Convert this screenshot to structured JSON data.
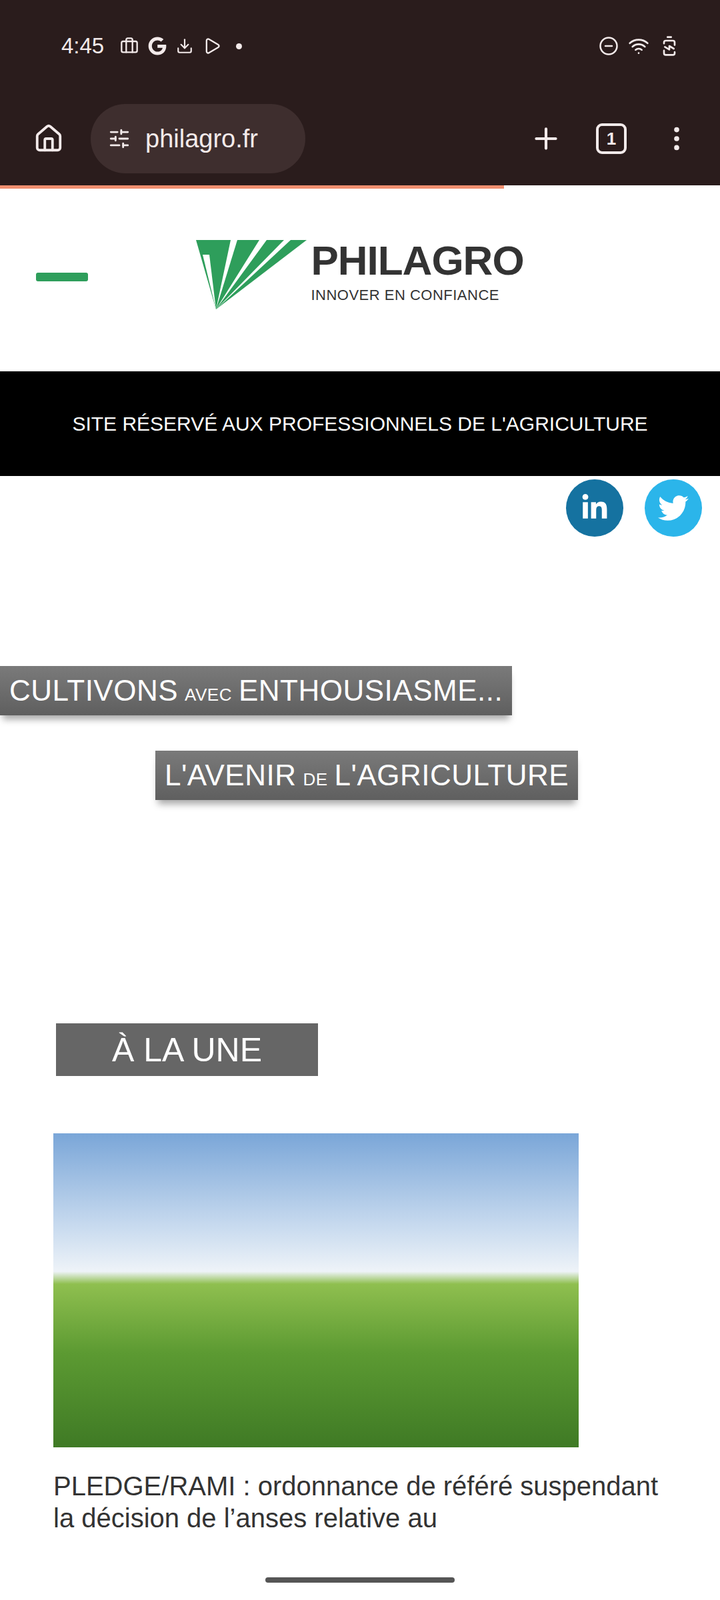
{
  "status_bar": {
    "time": "4:45"
  },
  "browser": {
    "url": "philagro.fr",
    "tab_count": "1",
    "load_progress": 0.7
  },
  "header": {
    "logo": {
      "name": "PHILAGRO",
      "tagline": "INNOVER EN CONFIANCE"
    }
  },
  "banner": "SITE RÉSERVÉ AUX PROFESSIONNELS DE L'AGRICULTURE",
  "social": [
    {
      "kind": "linkedin",
      "color": "#1572a0"
    },
    {
      "kind": "twitter",
      "color": "#2bb5ea"
    }
  ],
  "slogan": [
    {
      "parts": [
        {
          "text": "CULTIVONS",
          "small": false
        },
        {
          "text": "AVEC",
          "small": true
        },
        {
          "text": "ENTHOUSIASME...",
          "small": false
        }
      ]
    },
    {
      "parts": [
        {
          "text": "L'AVENIR",
          "small": false
        },
        {
          "text": "DE",
          "small": true
        },
        {
          "text": "L'AGRICULTURE",
          "small": false
        }
      ]
    }
  ],
  "section": {
    "title": "À LA UNE"
  },
  "articles": [
    {
      "headline": "PLEDGE/RAMI : ordonnance de référé suspendant la décision de l’anses relative au"
    }
  ]
}
